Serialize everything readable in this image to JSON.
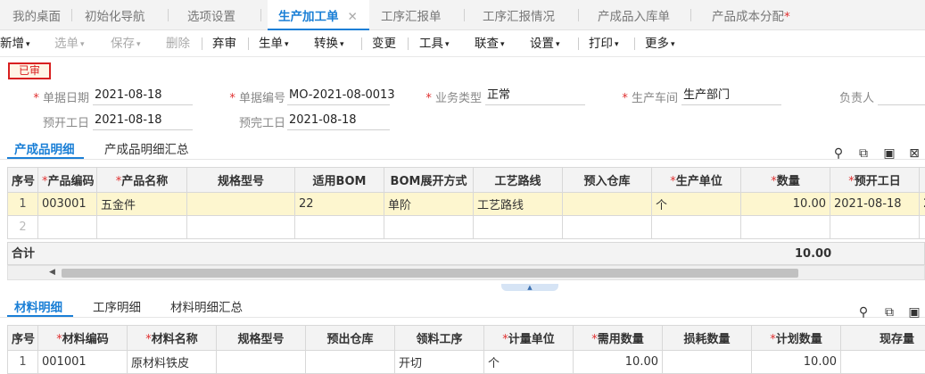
{
  "tabs": [
    {
      "label": "我的桌面"
    },
    {
      "label": "初始化导航"
    },
    {
      "label": "选项设置"
    },
    {
      "label": "生产加工单",
      "close": "✕"
    },
    {
      "label": "工序汇报单"
    },
    {
      "label": "工序汇报情况"
    },
    {
      "label": "产成品入库单"
    },
    {
      "label": "产品成本分配",
      "mark": "*"
    }
  ],
  "toolbar": [
    {
      "label": "新增",
      "caret": "▾"
    },
    {
      "label": "选单",
      "caret": "▾"
    },
    {
      "label": "保存",
      "caret": "▾"
    },
    {
      "label": "删除"
    },
    {
      "label": "弃审"
    },
    {
      "label": "生单",
      "caret": "▾"
    },
    {
      "label": "转换",
      "caret": "▾"
    },
    {
      "label": "变更"
    },
    {
      "label": "工具",
      "caret": "▾"
    },
    {
      "label": "联查",
      "caret": "▾"
    },
    {
      "label": "设置",
      "caret": "▾"
    },
    {
      "label": "打印",
      "caret": "▾"
    },
    {
      "label": "更多",
      "caret": "▾"
    }
  ],
  "status_stamp": "已审",
  "form": {
    "doc_date_label": "单据日期",
    "doc_date": "2021-08-18",
    "doc_no_label": "单据编号",
    "doc_no": "MO-2021-08-0013",
    "biz_type_label": "业务类型",
    "biz_type": "正常",
    "workshop_label": "生产车间",
    "workshop": "生产部门",
    "owner_label": "负责人",
    "plan_start_label": "预开工日",
    "plan_start": "2021-08-18",
    "plan_end_label": "预完工日",
    "plan_end": "2021-08-18"
  },
  "req_mark": "*",
  "product_section": {
    "tab1": "产成品明细",
    "tab2": "产成品明细汇总",
    "headers": [
      "序号",
      "产品编码",
      "产品名称",
      "规格型号",
      "适用BOM",
      "BOM展开方式",
      "工艺路线",
      "预入仓库",
      "生产单位",
      "数量",
      "预开工日"
    ],
    "rows": [
      {
        "no": "1",
        "code": "003001",
        "name": "五金件",
        "spec": "",
        "bom": "22",
        "expand": "单阶",
        "route": "工艺路线",
        "wh": "",
        "unit": "个",
        "qty": "10.00",
        "start": "2021-08-18",
        "extra": "2"
      },
      {
        "no": "2"
      }
    ],
    "total_label": "合计",
    "total_qty": "10.00"
  },
  "material_section": {
    "tab1": "材料明细",
    "tab2": "工序明细",
    "tab3": "材料明细汇总",
    "headers": [
      "序号",
      "材料编码",
      "材料名称",
      "规格型号",
      "预出仓库",
      "领料工序",
      "计量单位",
      "需用数量",
      "损耗数量",
      "计划数量",
      "现存量"
    ],
    "row": {
      "no": "1",
      "code": "001001",
      "name": "原材料铁皮",
      "process": "开切",
      "unit": "个",
      "need": "10.00",
      "plan": "10.00"
    }
  },
  "icons": [
    "location-icon",
    "copy-icon",
    "paste-icon",
    "delete-row-icon"
  ]
}
